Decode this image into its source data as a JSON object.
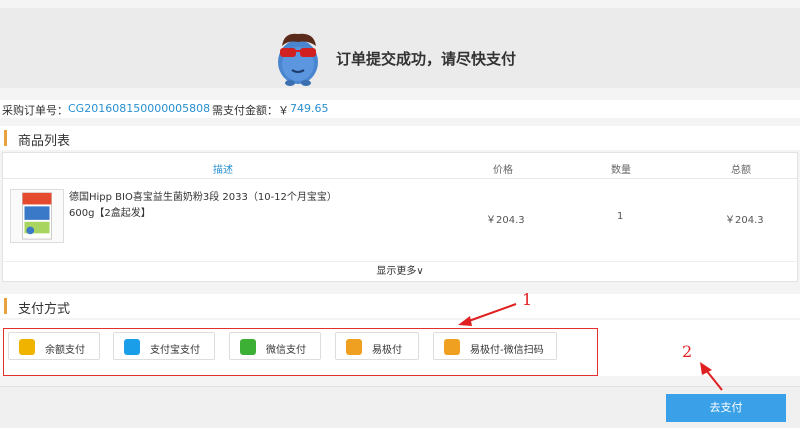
{
  "banner": {
    "message": "订单提交成功，请尽快支付"
  },
  "order": {
    "number_label": "采购订单号：",
    "number_value": "CG201608150000005808",
    "amount_label": "需支付金额：￥",
    "amount_value": "749.65"
  },
  "products_section": {
    "title": "商品列表"
  },
  "table": {
    "headers": {
      "desc": "描述",
      "price": "价格",
      "qty": "数量",
      "total": "总额"
    },
    "rows": [
      {
        "name_line1": "德国Hipp BIO喜宝益生菌奶粉3段 2033（10-12个月宝宝）",
        "name_line2": "600g【2盒起发】",
        "price": "￥204.3",
        "qty": "1",
        "total": "￥204.3",
        "image_icon": "hipp-milk-box-icon"
      }
    ],
    "show_more": "显示更多∨"
  },
  "payment_section": {
    "title": "支付方式"
  },
  "payment_methods": [
    {
      "label": "余额支付",
      "icon": "balance-icon",
      "color": "#f0b400"
    },
    {
      "label": "支付宝支付",
      "icon": "alipay-icon",
      "color": "#1a9ee8"
    },
    {
      "label": "微信支付",
      "icon": "wechat-icon",
      "color": "#3cb034"
    },
    {
      "label": "易极付",
      "icon": "card-icon",
      "color": "#f0a020"
    },
    {
      "label": "易极付-微信扫码",
      "icon": "card-icon",
      "color": "#f0a020"
    }
  ],
  "pay_button": {
    "label": "去支付",
    "color": "#3aa0e8"
  },
  "annotations": {
    "one": "1",
    "two": "2",
    "color": "#e02020"
  }
}
